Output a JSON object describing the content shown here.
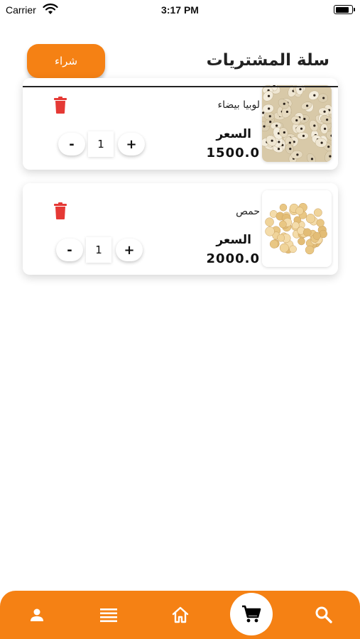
{
  "status_bar": {
    "carrier": "Carrier",
    "time": "3:17 PM",
    "battery_level": 0.9
  },
  "header": {
    "title": "سلة المشتريات",
    "buy_label": "شراء"
  },
  "cart_items": [
    {
      "name": "لوبيا بيضاء",
      "price_label": "السعر",
      "price": "1500.0",
      "quantity": "1",
      "minus": "-",
      "plus": "+",
      "image": "black-eyed-peas-photo"
    },
    {
      "name": "حمص",
      "price_label": "السعر",
      "price": "2000.0",
      "quantity": "1",
      "minus": "-",
      "plus": "+",
      "image": "chickpeas-photo"
    }
  ],
  "bottom_nav": {
    "active": "cart",
    "items": [
      "profile-icon",
      "list-icon",
      "home-icon",
      "cart-icon",
      "search-icon"
    ]
  },
  "colors": {
    "accent": "#f58114",
    "delete": "#e53935"
  }
}
